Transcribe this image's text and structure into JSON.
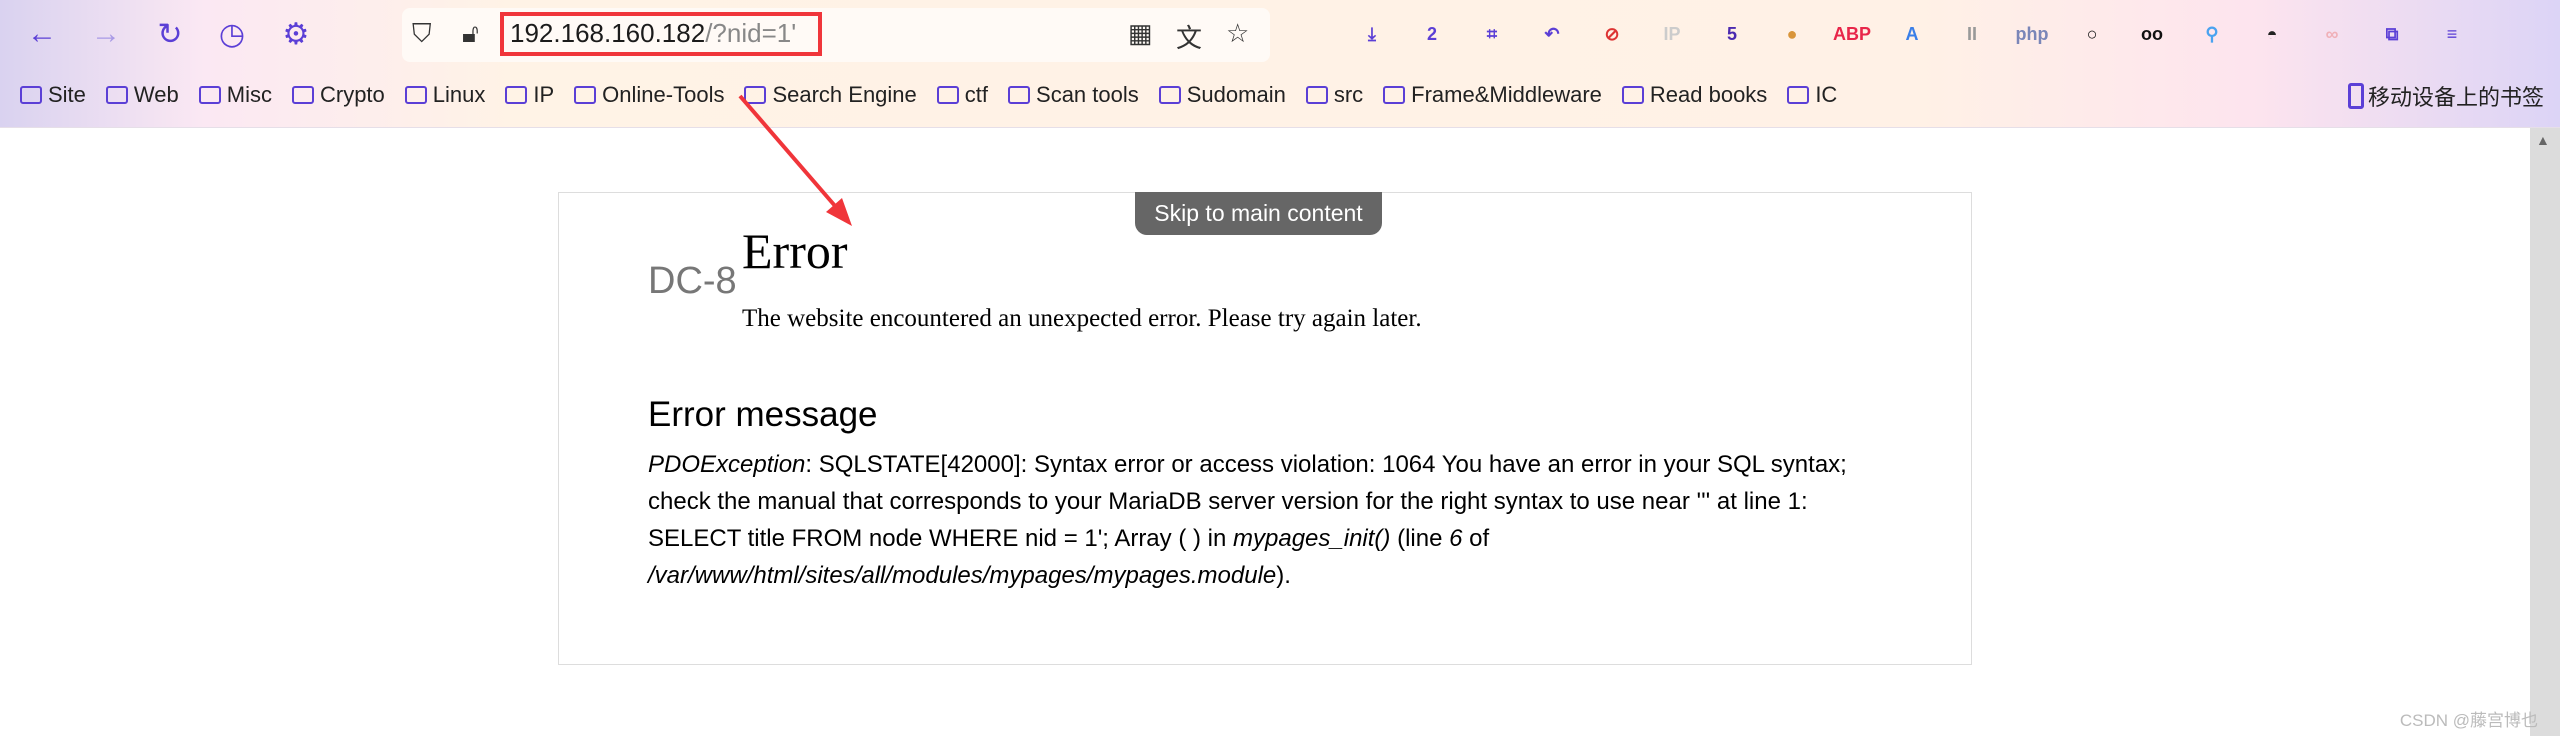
{
  "browser": {
    "url_host": "192.168.160.182",
    "url_path": "/?nid=1'",
    "bookmarks": [
      "Site",
      "Web",
      "Misc",
      "Crypto",
      "Linux",
      "IP",
      "Online-Tools",
      "Search Engine",
      "ctf",
      "Scan tools",
      "Sudomain",
      "src",
      "Frame&Middleware",
      "Read books",
      "IC"
    ],
    "mobile_bookmarks": "移动设备上的书签",
    "extensions": [
      {
        "name": "download-icon",
        "label": "⤓",
        "color": "#5b3fd6"
      },
      {
        "name": "badge-2-icon",
        "label": "2",
        "color": "#5b3fd6"
      },
      {
        "name": "crop-icon",
        "label": "⌗",
        "color": "#5b3fd6"
      },
      {
        "name": "undo-icon",
        "label": "↶",
        "color": "#5b3fd6"
      },
      {
        "name": "blocked-icon",
        "label": "⊘",
        "color": "#d33"
      },
      {
        "name": "ip-icon",
        "label": "IP",
        "color": "#ccc"
      },
      {
        "name": "layers-5-icon",
        "label": "5",
        "color": "#4b2ab0"
      },
      {
        "name": "cookie-icon",
        "label": "●",
        "color": "#d9953a"
      },
      {
        "name": "abp-icon",
        "label": "ABP",
        "color": "#e8264a"
      },
      {
        "name": "translate-icon",
        "label": "A",
        "color": "#3a7fe8"
      },
      {
        "name": "paused-icon",
        "label": "II",
        "color": "#999"
      },
      {
        "name": "php-icon",
        "label": "php",
        "color": "#7a86b8"
      },
      {
        "name": "circle-icon",
        "label": "○",
        "color": "#111"
      },
      {
        "name": "glasses-icon",
        "label": "oo",
        "color": "#111"
      },
      {
        "name": "pin-icon",
        "label": "⚲",
        "color": "#4aa3f0"
      },
      {
        "name": "hat-icon",
        "label": "◓",
        "color": "#222"
      },
      {
        "name": "rings-icon",
        "label": "∞",
        "color": "#f0b0b8"
      },
      {
        "name": "extensions-icon",
        "label": "⧉",
        "color": "#5b3fd6"
      },
      {
        "name": "menu-icon",
        "label": "≡",
        "color": "#5b3fd6"
      }
    ]
  },
  "page": {
    "skip_link": "Skip to main content",
    "site_name": "DC-8",
    "title": "Error",
    "subtitle": "The website encountered an unexpected error. Please try again later.",
    "message_heading": "Error message",
    "message": {
      "exception": "PDOException",
      "text1": ": SQLSTATE[42000]: Syntax error or access violation: 1064 You have an error in your SQL syntax; check the manual that corresponds to your MariaDB server version for the right syntax to use near ''' at line 1: SELECT title FROM node WHERE nid = 1'; Array ( ) in ",
      "function": "mypages_init()",
      "text2": " (line ",
      "line": "6",
      "text3": " of ",
      "file": "/var/www/html/sites/all/modules/mypages/mypages.module",
      "text4": ")."
    }
  },
  "watermark": "CSDN @藤宫博也",
  "annotation_color": "#f0353a"
}
